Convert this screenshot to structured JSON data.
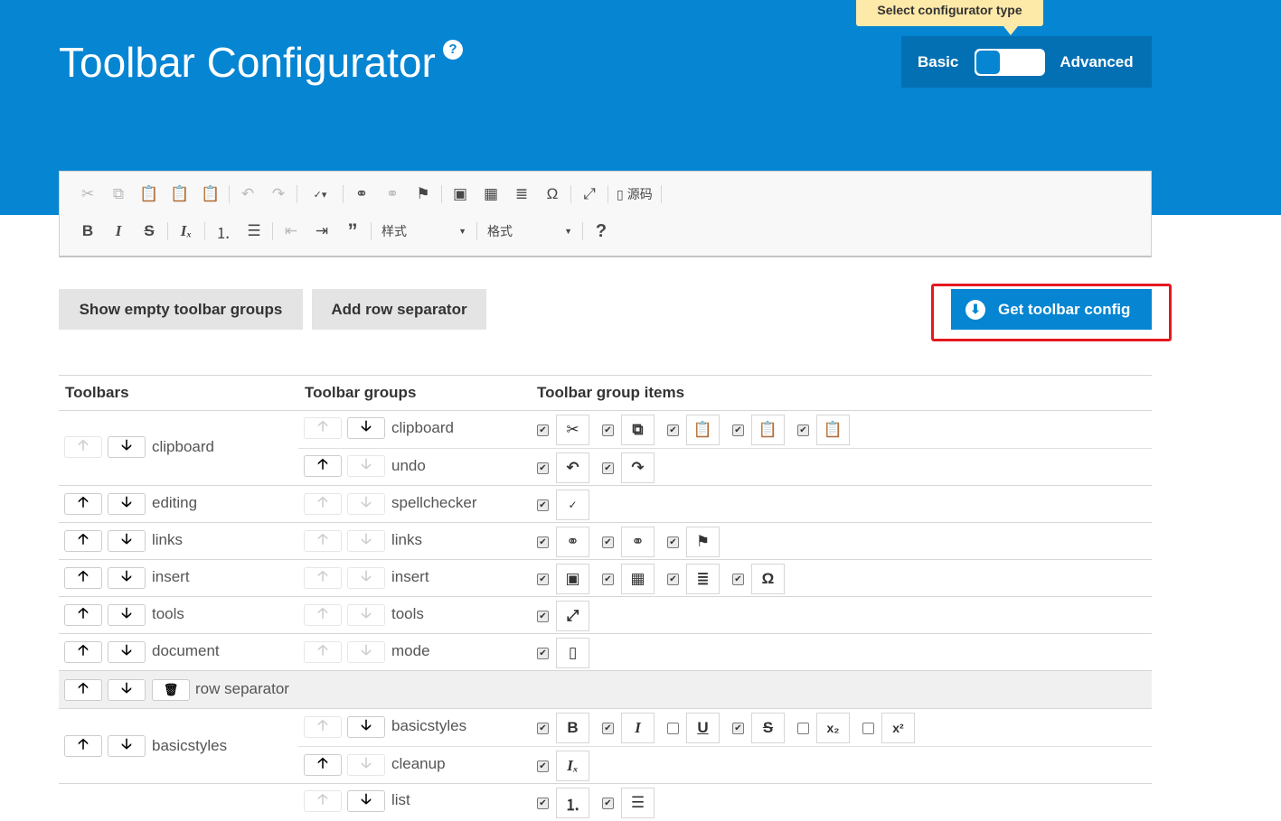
{
  "header": {
    "title": "Toolbar Configurator",
    "help_symbol": "?",
    "tooltip": "Select configurator type",
    "switch_left": "Basic",
    "switch_right": "Advanced"
  },
  "editor_toolbar": {
    "source_label": "源码",
    "styles_label": "样式",
    "format_label": "格式",
    "help_symbol": "?"
  },
  "actions": {
    "show_empty": "Show empty toolbar groups",
    "add_separator": "Add row separator",
    "get_config": "Get toolbar config"
  },
  "table": {
    "col_toolbars": "Toolbars",
    "col_groups": "Toolbar groups",
    "col_items": "Toolbar group items",
    "rows": {
      "clipboard": "clipboard",
      "clipboard_g1": "clipboard",
      "clipboard_g2": "undo",
      "editing": "editing",
      "editing_g1": "spellchecker",
      "links": "links",
      "links_g1": "links",
      "insert": "insert",
      "insert_g1": "insert",
      "tools": "tools",
      "tools_g1": "tools",
      "document": "document",
      "document_g1": "mode",
      "row_separator": "row separator",
      "basicstyles": "basicstyles",
      "basicstyles_g1": "basicstyles",
      "basicstyles_g2": "cleanup",
      "list_g1": "list"
    }
  },
  "colors": {
    "brand_blue": "#0585d2",
    "highlight_red": "#e5191f",
    "tooltip_yellow": "#fde9a8"
  }
}
